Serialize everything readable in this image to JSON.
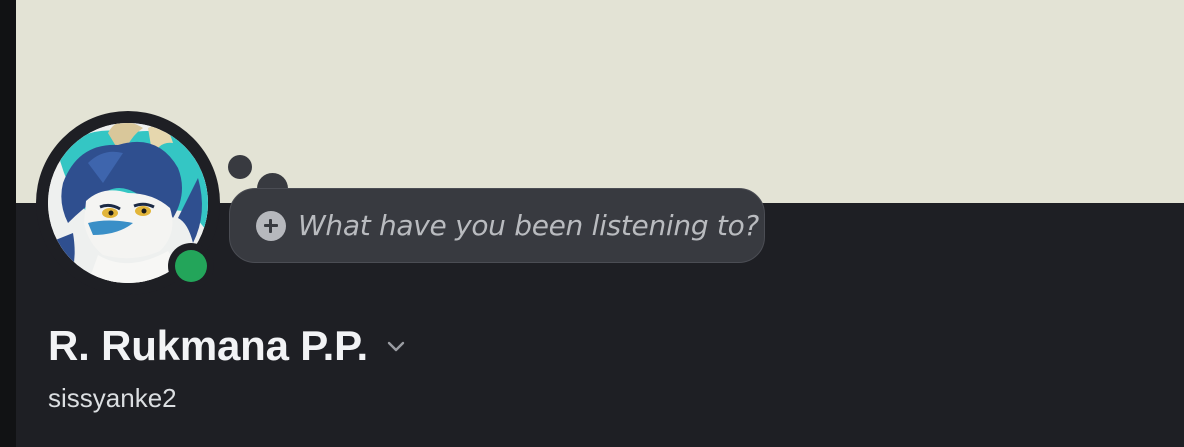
{
  "profile": {
    "display_name": "R. Rukmana P.P.",
    "username": "sissyanke2",
    "status": "online",
    "status_color": "#23a55a",
    "banner_color": "#e3e3d5",
    "avatar_icon": "dragon-avatar"
  },
  "custom_status": {
    "placeholder": "What have you been listening to?",
    "add_icon": "plus-circle-icon"
  },
  "name_menu_icon": "chevron-down-icon"
}
